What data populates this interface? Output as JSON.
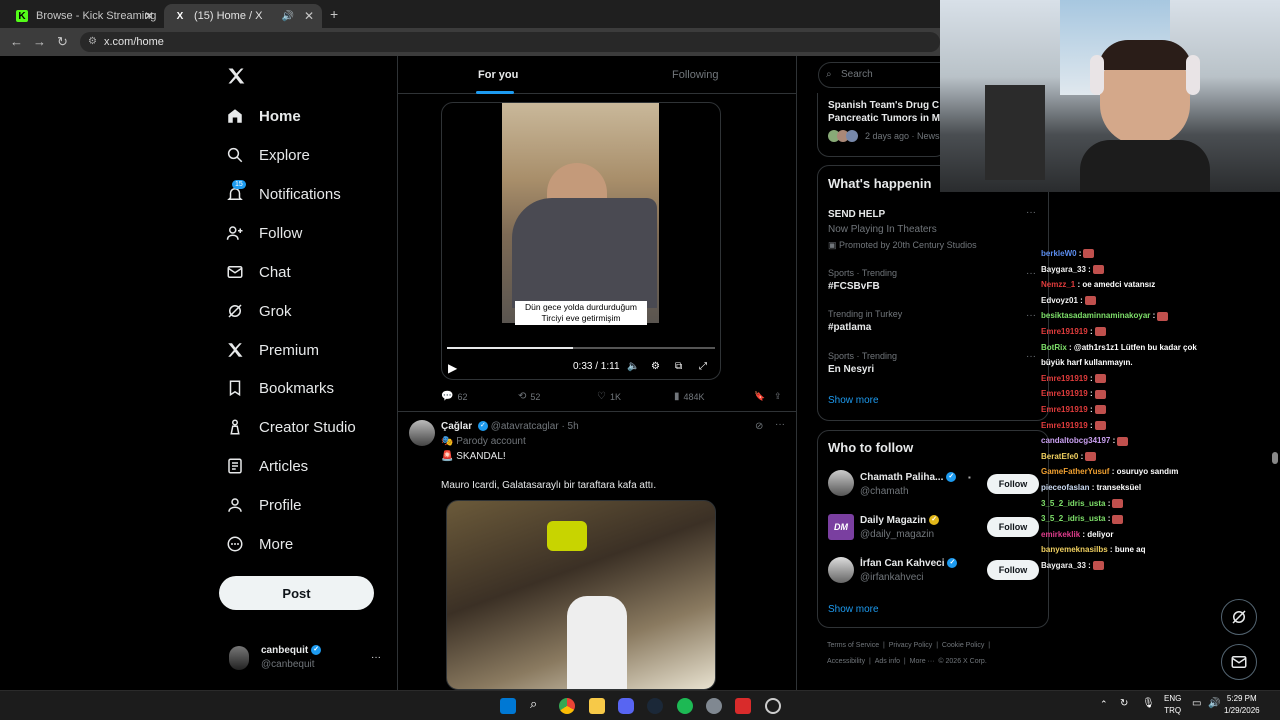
{
  "browser": {
    "tabs": [
      {
        "title": "Browse - Kick Streaming",
        "favicon": "K"
      },
      {
        "title": "(15) Home / X",
        "favicon": "X"
      }
    ],
    "url": "x.com/home"
  },
  "nav": {
    "items": [
      {
        "label": "Home",
        "icon": "home-icon"
      },
      {
        "label": "Explore",
        "icon": "search-icon"
      },
      {
        "label": "Notifications",
        "icon": "bell-icon",
        "badge": "15"
      },
      {
        "label": "Follow",
        "icon": "person-plus-icon"
      },
      {
        "label": "Chat",
        "icon": "mail-icon"
      },
      {
        "label": "Grok",
        "icon": "grok-icon"
      },
      {
        "label": "Premium",
        "icon": "x-logo-icon"
      },
      {
        "label": "Bookmarks",
        "icon": "bookmark-icon"
      },
      {
        "label": "Creator Studio",
        "icon": "creator-icon"
      },
      {
        "label": "Articles",
        "icon": "article-icon"
      },
      {
        "label": "Profile",
        "icon": "person-icon"
      },
      {
        "label": "More",
        "icon": "more-circle-icon"
      }
    ],
    "post_label": "Post",
    "account": {
      "name": "canbequit",
      "handle": "@canbequit"
    }
  },
  "feed": {
    "tabs": [
      "For you",
      "Following"
    ],
    "post1": {
      "caption_line1": "Dün gece yolda durdurduğum",
      "caption_line2": "Tirciyi eve getirmişim",
      "time": "0:33 / 1:11",
      "progress": 0.47,
      "replies": "62",
      "reposts": "52",
      "likes": "1K",
      "views": "484K"
    },
    "post2": {
      "name": "Çağlar",
      "handle": "@atavratcaglar",
      "time": "· 5h",
      "parody": "Parody account",
      "line1": "🚨 SKANDAL!",
      "line2": "Mauro Icardi, Galatasaraylı bir taraftara kafa attı."
    }
  },
  "sidebar": {
    "search_placeholder": "Search",
    "news": {
      "title_line1": "Spanish Team's Drug C",
      "title_line2": "Pancreatic Tumors in M",
      "meta": "2 days ago · News"
    },
    "whats_happening": "What's happenin",
    "trends": [
      {
        "meta": "",
        "name": "SEND HELP",
        "sub1": "Now Playing In Theaters",
        "sub2": "Promoted by 20th Century Studios"
      },
      {
        "meta": "Sports · Trending",
        "name": "#FCSBvFB"
      },
      {
        "meta": "Trending in Turkey",
        "name": "#patlama"
      },
      {
        "meta": "Sports · Trending",
        "name": "En Nesyri"
      }
    ],
    "show_more": "Show more",
    "who_to_follow": "Who to follow",
    "follow_label": "Follow",
    "suggestions": [
      {
        "name": "Chamath Paliha...",
        "handle": "@chamath"
      },
      {
        "name": "Daily Magazin",
        "handle": "@daily_magazin",
        "avatar_text": "DM"
      },
      {
        "name": "İrfan Can Kahveci",
        "handle": "@irfankahveci"
      }
    ],
    "footer1": [
      "Terms of Service",
      "|",
      "Privacy Policy",
      "|",
      "Cookie Policy",
      "|"
    ],
    "footer2": [
      "Accessibility",
      "|",
      "Ads info",
      "|",
      "More ···",
      "© 2026 X Corp."
    ]
  },
  "chat": [
    {
      "user": "berkleW0",
      "color": "#5b8def",
      "msg": ":",
      "emote": true
    },
    {
      "user": "Baygara_33",
      "color": "#f0f0f0",
      "msg": ":",
      "emote": true
    },
    {
      "user": "Nemzz_1",
      "color": "#e03c3c",
      "msg": ": oe amedci vatansız"
    },
    {
      "user": "Edvoyz01",
      "color": "#f0f0f0",
      "msg": ":",
      "emote": true
    },
    {
      "user": "besiktasadaminnaminakoyar",
      "color": "#7ee06a",
      "msg": ":",
      "emote": true
    },
    {
      "user": "Emre191919",
      "color": "#e03c3c",
      "msg": ":",
      "emote": true
    },
    {
      "user": "BotRix",
      "color": "#7ee06a",
      "msg": ": @ath1rs1z1 Lütfen bu kadar çok"
    },
    {
      "user": "",
      "color": "#fff",
      "msg": "büyük harf kullanmayın."
    },
    {
      "user": "Emre191919",
      "color": "#e03c3c",
      "msg": ":",
      "emote": true
    },
    {
      "user": "Emre191919",
      "color": "#e03c3c",
      "msg": ":",
      "emote": true
    },
    {
      "user": "Emre191919",
      "color": "#e03c3c",
      "msg": ":",
      "emote": true
    },
    {
      "user": "Emre191919",
      "color": "#e03c3c",
      "msg": ":",
      "emote": true
    },
    {
      "user": "candaltobcg34197",
      "color": "#c9a0f0",
      "msg": ":",
      "emote": true
    },
    {
      "user": "BeratEfe0",
      "color": "#f0d060",
      "msg": ":",
      "emote": true
    },
    {
      "user": "GameFatherYusuf",
      "color": "#f0a030",
      "msg": ": osuruyo sandım"
    },
    {
      "user": "pieceofaslan",
      "color": "#c9d9f0",
      "msg": ": transeksüel"
    },
    {
      "user": "3_5_2_idris_usta",
      "color": "#7ee06a",
      "msg": ":",
      "emote": true
    },
    {
      "user": "3_5_2_idris_usta",
      "color": "#7ee06a",
      "msg": ":",
      "emote": true
    },
    {
      "user": "emirkeklik",
      "color": "#e03c8c",
      "msg": ": deliyor"
    },
    {
      "user": "banyemeknasilbs",
      "color": "#f0d060",
      "msg": ": bune aq"
    },
    {
      "user": "Baygara_33",
      "color": "#f0f0f0",
      "msg": ":",
      "emote": true
    }
  ],
  "taskbar": {
    "lang1": "ENG",
    "lang2": "TRQ",
    "time": "5:29 PM",
    "date": "1/29/2026"
  }
}
